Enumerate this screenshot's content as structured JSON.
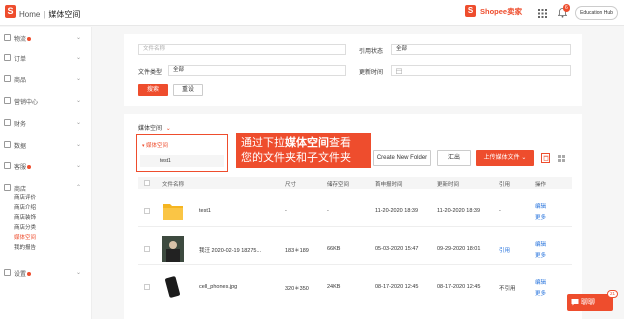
{
  "topbar": {
    "logo_letter": "S",
    "home": "Home",
    "current": "媒体空间",
    "brand_letter": "S",
    "brand": "Shopee卖家",
    "notification_count": "6",
    "hub_button": "Education Hub"
  },
  "sidebar": {
    "items": [
      {
        "label": "物流",
        "dot": true
      },
      {
        "label": "订单",
        "dot": false
      },
      {
        "label": "商品",
        "dot": false
      },
      {
        "label": "营销中心",
        "dot": false
      },
      {
        "label": "财务",
        "dot": false
      },
      {
        "label": "数据",
        "dot": false
      },
      {
        "label": "客服",
        "dot": true
      },
      {
        "label": "商店",
        "dot": false
      }
    ],
    "shop_sub": [
      "商店评价",
      "商店介绍",
      "商店装饰",
      "商店分类",
      "媒体空间",
      "我的报告"
    ],
    "settings": "设置"
  },
  "filters": {
    "name_placeholder": "文件名称",
    "ref_status_label": "引用状态",
    "ref_status_value": "全部",
    "type_label": "文件类型",
    "type_value": "全部",
    "time_label": "更新时间",
    "search_button": "搜索",
    "reset_button": "重设"
  },
  "toolbar": {
    "folder_selector": "媒体空间",
    "create_folder": "Create New Folder",
    "export": "汇出",
    "upload": "上传媒体文件"
  },
  "dropdown": {
    "root": "媒体空间",
    "child": "test1"
  },
  "annotation": {
    "line1_pre": "通过下拉",
    "line1_bold": "媒体空间",
    "line1_post": "查看",
    "line2": "您的文件夹和子文件夹"
  },
  "table": {
    "headers": [
      "文件名称",
      "尺寸",
      "储存空间",
      "首申报时间",
      "更新时间",
      "引用",
      "操作"
    ],
    "rows": [
      {
        "name": "test1",
        "size": "-",
        "storage": "-",
        "first_time": "11-20-2020 18:39",
        "updated": "11-20-2020 18:39",
        "ref": "-",
        "actions": [
          "编辑",
          "更多"
        ],
        "thumb": "folder"
      },
      {
        "name": "我汪 2020-02-19 18275...",
        "size": "183＊189",
        "storage": "66KB",
        "first_time": "05-03-2020 15:47",
        "updated": "09-29-2020 18:01",
        "ref": "引用",
        "actions": [
          "编辑",
          "更多"
        ],
        "thumb": "person"
      },
      {
        "name": "cell_phones.jpg",
        "size": "320＊350",
        "storage": "24KB",
        "first_time": "08-17-2020 12:45",
        "updated": "08-17-2020 12:45",
        "ref": "不引用",
        "actions": [
          "编辑",
          "更多"
        ],
        "thumb": "phone"
      }
    ]
  },
  "chat": {
    "label": "聊聊",
    "badge": "21"
  },
  "colors": {
    "accent": "#ee4d2d",
    "link": "#2673dd"
  }
}
